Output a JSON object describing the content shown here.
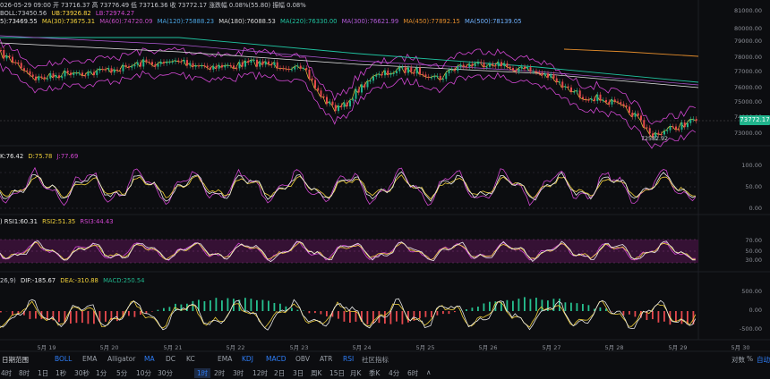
{
  "header": {
    "line1": "026-05-29 09:00 开 73716.37 高 73776.49 低 73716.36 收 73772.17 涨跌幅 0.08%(55.80) 振幅 0.08%",
    "boll": {
      "label": "BOLL:73450.56",
      "ub": "UB:73926.82",
      "lb": "LB:72974.27"
    },
    "ma": [
      "5):73469.55",
      "MA(30):73675.31",
      "MA(60):74720.09",
      "MA(120):75888.23",
      "MA(180):76088.53",
      "MA(220):76330.00",
      "MA(300):76621.99",
      "MA(450):77892.15",
      "MA(500):78139.05"
    ]
  },
  "price_axis": [
    "81000.00",
    "80000.00",
    "79000.00",
    "78000.00",
    "77000.00",
    "76000.00",
    "75000.00",
    "74000.00",
    "73000.00"
  ],
  "last_price": "73772.17",
  "low_marker": "72582.92",
  "kdj": {
    "k": "K:76.42",
    "d": "D:75.78",
    "j": "J:77.69",
    "axis": [
      "100.00",
      "50.00",
      "0.00"
    ]
  },
  "rsi": {
    "r1": ") RSI1:60.31",
    "r2": "RSI2:51.35",
    "r3": "RSI3:44.43",
    "axis": [
      "70.00",
      "50.00",
      "30.00"
    ]
  },
  "macd": {
    "prefix": "26,9)",
    "dif": "DIF:-185.67",
    "dea": "DEA:-310.88",
    "macd": "MACD:250.54",
    "axis": [
      "500.00",
      "0.00",
      "-500.00"
    ]
  },
  "dates": [
    "5月 19",
    "5月 20",
    "5月 21",
    "5月 22",
    "5月 23",
    "5月 24",
    "5月 25",
    "5月 26",
    "5月 27",
    "5月 28",
    "5月 29",
    "5月 30"
  ],
  "indicator_bar": {
    "left": "日期范围",
    "items": [
      "BOLL",
      "EMA",
      "Alligator",
      "MA",
      "DC",
      "KC",
      "EMA",
      "KDJ",
      "MACD",
      "OBV",
      "ATR",
      "RSI",
      "社区指标"
    ],
    "right": [
      "对数",
      "%",
      "自动"
    ]
  },
  "interval_bar": [
    "4时",
    "8时",
    "1日",
    "1秒",
    "30秒",
    "1分",
    "5分",
    "10分",
    "30分",
    "1时",
    "2时",
    "3时",
    "12时",
    "2日",
    "3日",
    "周K",
    "15日",
    "月K",
    "季K",
    "4分",
    "6时"
  ],
  "interval_bar_tail": "∧",
  "colors": {
    "up": "#20b48c",
    "down": "#e5484d",
    "boll_band": "#b03fb0",
    "macd_up": "#26c18f",
    "macd_down": "#e5484d"
  }
}
